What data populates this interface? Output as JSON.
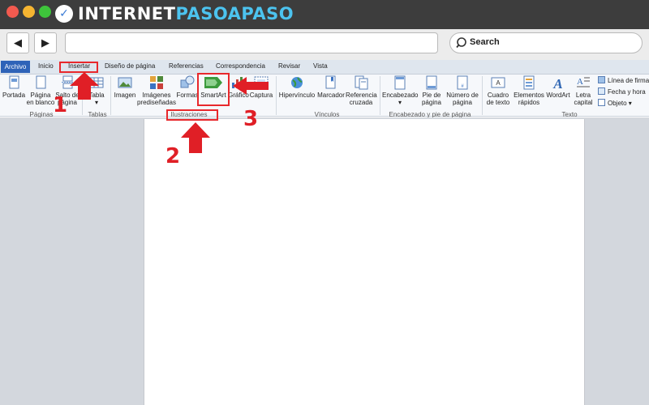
{
  "browser": {
    "logo": "INTERNETPASOAPASO",
    "search_placeholder": "Search",
    "back_symbol": "◀",
    "forward_symbol": "▶"
  },
  "ribbon_tabs": [
    "Archivo",
    "Inicio",
    "Insertar",
    "Diseño de página",
    "Referencias",
    "Correspondencia",
    "Revisar",
    "Vista"
  ],
  "ribbon": {
    "paginas": {
      "portada": "Portada",
      "pagina_en_blanco": [
        "Página",
        "en blanco"
      ],
      "salto": [
        "Salto de",
        "página"
      ],
      "label": "Páginas"
    },
    "tablas": {
      "tabla": "Tabla",
      "label": "Tablas"
    },
    "ilustraciones": {
      "imagen": "Imagen",
      "imagenes_prediseñadas": [
        "Imágenes",
        "prediseñadas"
      ],
      "formas": "Formas",
      "smartart": "SmartArt",
      "grafico": "Gráfico",
      "captura": "Captura",
      "label": "Ilustraciones"
    },
    "vinculos": {
      "hipervinculo": "Hipervínculo",
      "marcador": "Marcador",
      "referencia_cruzada": [
        "Referencia",
        "cruzada"
      ],
      "label": "Vínculos"
    },
    "encabezado": {
      "encabezado": "Encabezado",
      "pie": [
        "Pie de",
        "página"
      ],
      "numero": [
        "Número de",
        "página"
      ],
      "label": "Encabezado y pie de página"
    },
    "texto": {
      "cuadro": [
        "Cuadro",
        "de texto"
      ],
      "elementos": [
        "Elementos",
        "rápidos"
      ],
      "wordart": "WordArt",
      "letra": [
        "Letra",
        "capital"
      ],
      "linea_firma": "Línea de firma",
      "fecha_hora": "Fecha y hora",
      "objeto": "Objeto",
      "label": "Texto"
    }
  },
  "annotations": {
    "step1": "1",
    "step2": "2",
    "step3": "3"
  },
  "colors": {
    "accent_red": "#e8282c",
    "file_tab_blue": "#2e63b8"
  }
}
